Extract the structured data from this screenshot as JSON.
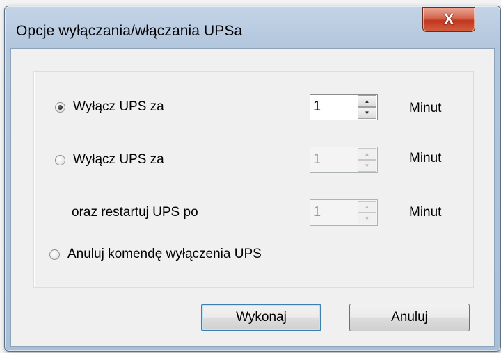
{
  "window": {
    "title": "Opcje wyłączania/włączania UPSa",
    "close_glyph": "X"
  },
  "options": {
    "shutdown": {
      "label": "Wyłącz UPS za",
      "selected": true,
      "value": "1",
      "unit": "Minut"
    },
    "shutdown_restart": {
      "label": "Wyłącz UPS za",
      "selected": false,
      "value": "1",
      "unit": "Minut",
      "restart_label": "oraz restartuj UPS po",
      "restart_value": "1",
      "restart_unit": "Minut"
    },
    "cancel_shutdown": {
      "label": "Anuluj komendę wyłączenia UPS",
      "selected": false
    }
  },
  "buttons": {
    "execute": "Wykonaj",
    "cancel": "Anuluj"
  },
  "icons": {
    "spin_up": "▲",
    "spin_down": "▼"
  },
  "colors": {
    "frame": "#b2c6dd",
    "close_button": "#c2361f",
    "dialog_bg": "#f0f0f0"
  }
}
